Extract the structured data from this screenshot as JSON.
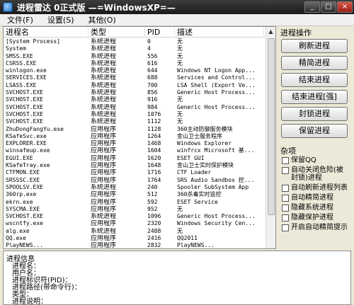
{
  "window": {
    "title": "进程雷达    0正式版    —=WindowsXP=—"
  },
  "menu": [
    "文件(F)",
    "设置(S)",
    "其他(O)"
  ],
  "table": {
    "columns": [
      "进程名",
      "类型",
      "PID",
      "描述"
    ],
    "rows": [
      [
        "[System Process]",
        "系统进程",
        "0",
        "无"
      ],
      [
        "System",
        "系统进程",
        "4",
        "无"
      ],
      [
        "SMSS.EXE",
        "系统进程",
        "556",
        "无"
      ],
      [
        "CSRSS.EXE",
        "系统进程",
        "616",
        "无"
      ],
      [
        "winlogon.exe",
        "系统进程",
        "644",
        "Windows NT Logon App..."
      ],
      [
        "SERVICES.EXE",
        "系统进程",
        "688",
        "Services and Control..."
      ],
      [
        "LSASS.EXE",
        "系统进程",
        "700",
        "LSA Shell (Export Ve..."
      ],
      [
        "SVCHOST.EXE",
        "系统进程",
        "856",
        "Generic Host Process..."
      ],
      [
        "SVCHOST.EXE",
        "系统进程",
        "916",
        "无"
      ],
      [
        "SVCHOST.EXE",
        "系统进程",
        "984",
        "Generic Host Process..."
      ],
      [
        "SVCHOST.EXE",
        "系统进程",
        "1076",
        "无"
      ],
      [
        "SVCHOST.EXE",
        "系统进程",
        "1112",
        "无"
      ],
      [
        "ZhuDongFangYu.exe",
        "应用程序",
        "1128",
        "360主动防御服务模块"
      ],
      [
        "KSafeSvc.exe",
        "应用程序",
        "1264",
        "金山卫士服务程序"
      ],
      [
        "EXPLORER.EXE",
        "应用程序",
        "1468",
        "Windows Explorer"
      ],
      [
        "winsafeup.exe",
        "应用程序",
        "1604",
        "winfrcx Microsoft 基..."
      ],
      [
        "EGUI.EXE",
        "应用程序",
        "1620",
        "ESET GUI"
      ],
      [
        "KSafeTray.exe",
        "应用程序",
        "1648",
        "金山卫士实时保护模块"
      ],
      [
        "CTFMON.EXE",
        "应用程序",
        "1716",
        "CTF Loader"
      ],
      [
        "SRSSSC.EXE",
        "应用程序",
        "1764",
        "SRS Audio Sandbox 控..."
      ],
      [
        "SPOOLSV.EXE",
        "系统进程",
        "240",
        "Spooler SubSystem App"
      ],
      [
        "360rp.exe",
        "应用程序",
        "512",
        "360杀毒实时监控"
      ],
      [
        "ekrn.exe",
        "应用程序",
        "592",
        "ESET Service"
      ],
      [
        "SYSCMA.EXE",
        "应用程序",
        "952",
        "无"
      ],
      [
        "SVCHOST.EXE",
        "系统进程",
        "1096",
        "Generic Host Process..."
      ],
      [
        "wscntfy.exe",
        "应用程序",
        "2320",
        "Windows Security Cen..."
      ],
      [
        "alg.exe",
        "系统进程",
        "2488",
        "无"
      ],
      [
        "QQ.exe",
        "应用程序",
        "2416",
        "QQ2011"
      ],
      [
        "PlayNEWS...",
        "应用程序",
        "2832",
        "PlayNEWS..."
      ]
    ]
  },
  "panel": {
    "ops_title": "进程操作",
    "buttons": [
      "刷新进程",
      "精简进程",
      "结束进程",
      "结束进程[强]",
      "封锁进程",
      "保留进程"
    ],
    "misc_title": "杂项",
    "checkboxes": [
      "保留QQ",
      "自动关闭危险(被封锁)进程",
      "自动刷新进程列表",
      "自动精简进程",
      "隐藏系统进程",
      "隐藏保护进程",
      "开启自动精简提示"
    ]
  },
  "info": {
    "title": "进程信息",
    "lines": [
      "进程名：",
      "用户名：",
      "进程标识符(PID)：",
      "进程路径(带命令行)：",
      "类型：",
      "进程说明："
    ]
  }
}
